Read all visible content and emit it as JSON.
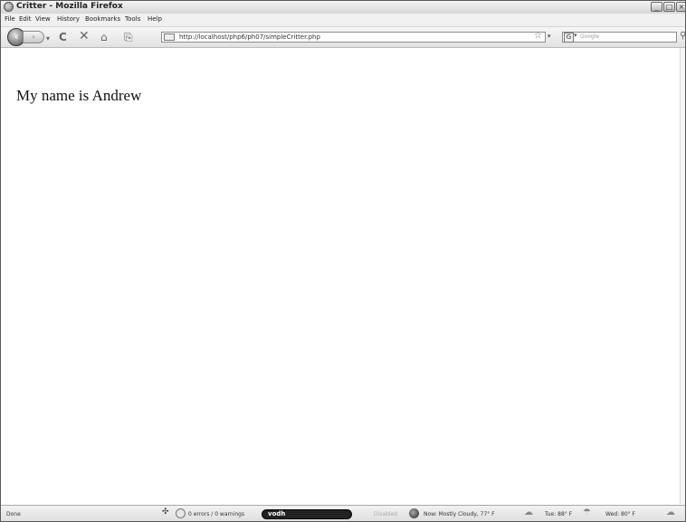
{
  "window": {
    "title": "Critter - Mozilla Firefox",
    "minimize_icon": "minimize-icon",
    "maximize_icon": "maximize-icon",
    "close_icon": "close-icon"
  },
  "menu": {
    "items": [
      "File",
      "Edit",
      "View",
      "History",
      "Bookmarks",
      "Tools",
      "Help"
    ]
  },
  "navbar": {
    "back_icon": "back-arrow-icon",
    "forward_icon": "forward-arrow-icon",
    "reload_icon": "reload-icon",
    "stop_icon": "stop-icon",
    "home_icon": "home-icon",
    "url": "http://localhost/php6/ph07/simpleCritter.php",
    "search_placeholder": "Google",
    "search_engine_label": "G"
  },
  "page": {
    "text": "My name is Andrew"
  },
  "status": {
    "left": "Done",
    "errors": "0 errors / 0 warnings",
    "vodh": "vodh",
    "disabled": "Disabled",
    "weather_now": "Now: Mostly Cloudy, 77° F",
    "weather_tue": "Tue: 88° F",
    "weather_wed": "Wed: 80° F"
  }
}
